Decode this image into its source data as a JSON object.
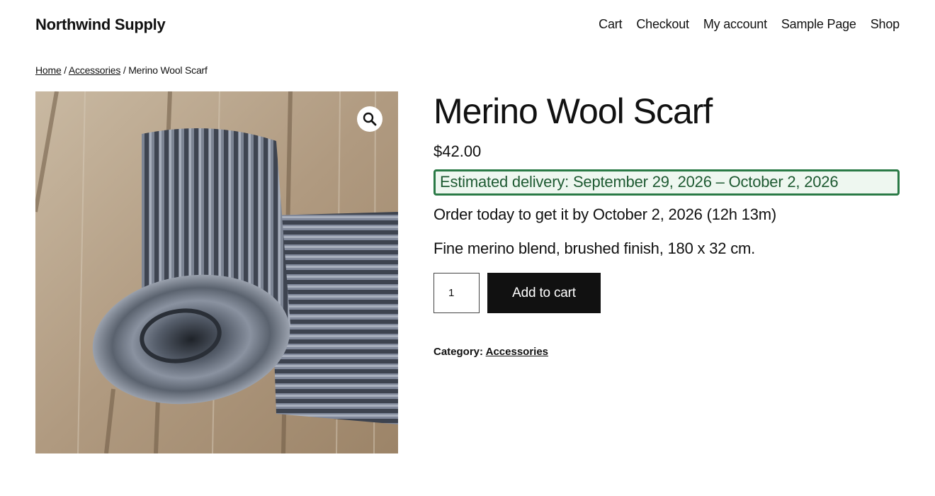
{
  "site": {
    "title": "Northwind Supply"
  },
  "nav": {
    "items": [
      {
        "label": "Cart"
      },
      {
        "label": "Checkout"
      },
      {
        "label": "My account"
      },
      {
        "label": "Sample Page"
      },
      {
        "label": "Shop"
      }
    ]
  },
  "breadcrumb": {
    "home": "Home",
    "sep1": " / ",
    "category": "Accessories",
    "sep2": " / ",
    "current": "Merino Wool Scarf"
  },
  "product": {
    "title": "Merino Wool Scarf",
    "price": "$42.00",
    "delivery_text": "Estimated delivery: September 29, 2026 – October 2, 2026",
    "order_text": "Order today to get it by October 2, 2026 (12h 13m)",
    "description": "Fine merino blend, brushed finish, 180 x 32 cm.",
    "quantity": "1",
    "add_to_cart_label": "Add to cart",
    "category_label": "Category: ",
    "category_value": "Accessories"
  },
  "icons": {
    "zoom": "magnifier-icon"
  },
  "colors": {
    "delivery_border": "#2a7a46",
    "delivery_bg": "#eef7f0",
    "delivery_text": "#1e5a32",
    "button_bg": "#111111"
  }
}
